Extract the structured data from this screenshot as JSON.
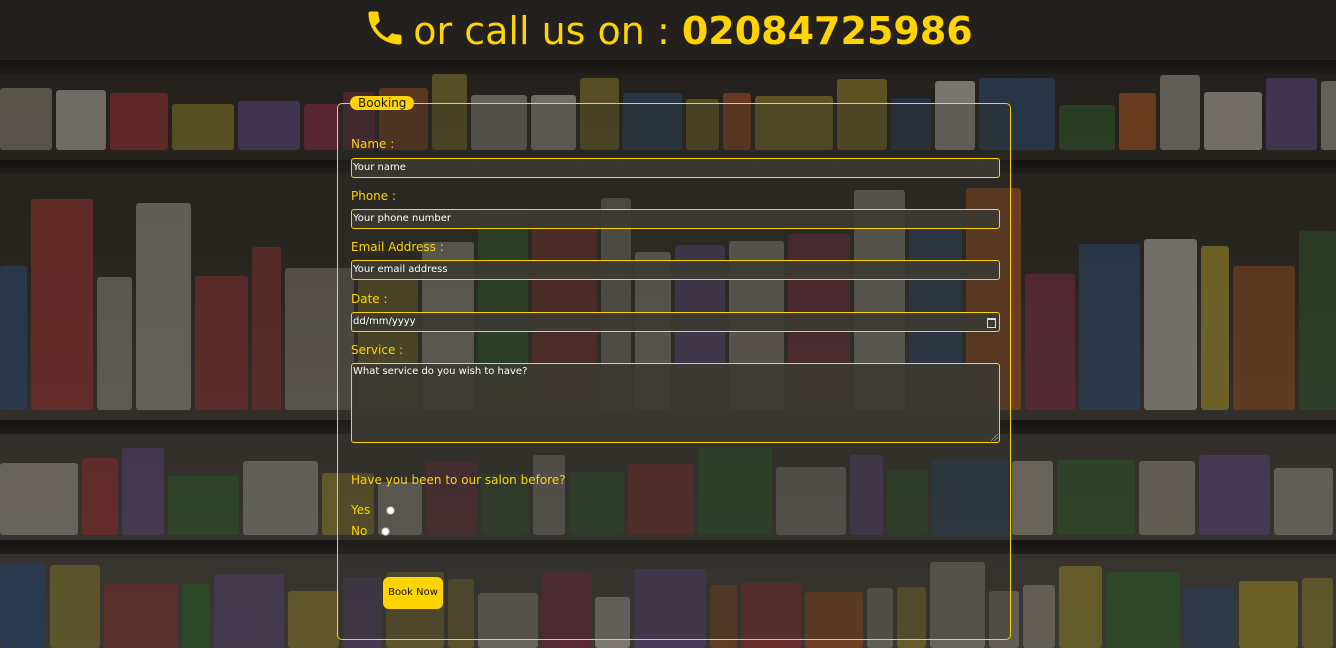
{
  "header": {
    "prefix": "or call us on :",
    "phone_number": "02084725986",
    "icon": "phone-icon"
  },
  "form": {
    "legend": "Booking",
    "name": {
      "label": "Name :",
      "placeholder": "Your name"
    },
    "phone": {
      "label": "Phone :",
      "placeholder": "Your phone number"
    },
    "email": {
      "label": "Email Address :",
      "placeholder": "Your email address"
    },
    "date": {
      "label": "Date :",
      "placeholder": "dd/mm/yyyy",
      "icon": "calendar-icon"
    },
    "service": {
      "label": "Service :",
      "placeholder": "What service do you wish to have?"
    },
    "visited": {
      "question": "Have you been to our salon before?",
      "options": [
        "Yes",
        "No"
      ]
    },
    "submit_label": "Book Now"
  },
  "colors": {
    "accent": "#ffd400",
    "input_text": "#ffffff"
  }
}
